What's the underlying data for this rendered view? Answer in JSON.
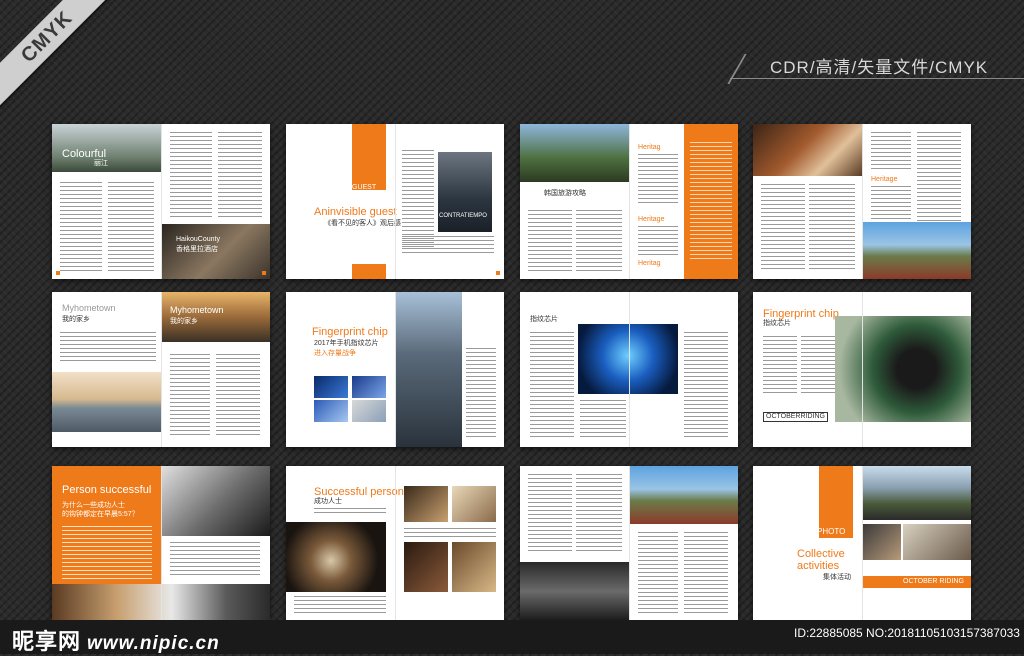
{
  "ribbon": "CMYK",
  "header_caption": "CDR/高清/矢量文件/CMYK",
  "footer": {
    "logo": "昵享网",
    "domain": "www.nipic.cn",
    "id_line": "ID:22885085 NO:20181105103157387033"
  },
  "spreads": {
    "s1": {
      "title": "Colourful",
      "sub": "丽江",
      "title2": "HaikouCounty",
      "title2_sub": "香格里拉酒店"
    },
    "s2": {
      "label": "GUEST",
      "title": "Aninvisible guest",
      "cn": "《看不见的客人》观后感",
      "poster": "CONTRATIEMPO"
    },
    "s3": {
      "heading": "韩国旅游攻略",
      "tag1": "Heritag",
      "tag2": "Heritage",
      "tag3": "Heritag"
    },
    "s4": {
      "tag": "Heritage"
    },
    "s5": {
      "title": "Myhometown",
      "cn": "我的家乡",
      "title2": "Myhometown",
      "title2_cn": "我的家乡"
    },
    "s6": {
      "title": "Fingerprint chip",
      "cn1": "2017年手机指纹芯片",
      "cn2": "进入存量战争"
    },
    "s7": {
      "heading": "指纹芯片"
    },
    "s8": {
      "title": "Fingerprint chip",
      "cn": "指纹芯片",
      "footer": "OCTOBERRIDING"
    },
    "s9": {
      "title": "Person successful",
      "cn1": "为什么一些成功人士",
      "cn2": "的钩钟都定在早晨5:57？"
    },
    "s10": {
      "title": "Successful person",
      "cn": "成功人士"
    },
    "s11": {},
    "s12": {
      "label": "PHOTO",
      "title1": "Collective",
      "title2": "activities",
      "cn": "集体活动",
      "footer": "OCTOBER RIDING"
    }
  }
}
